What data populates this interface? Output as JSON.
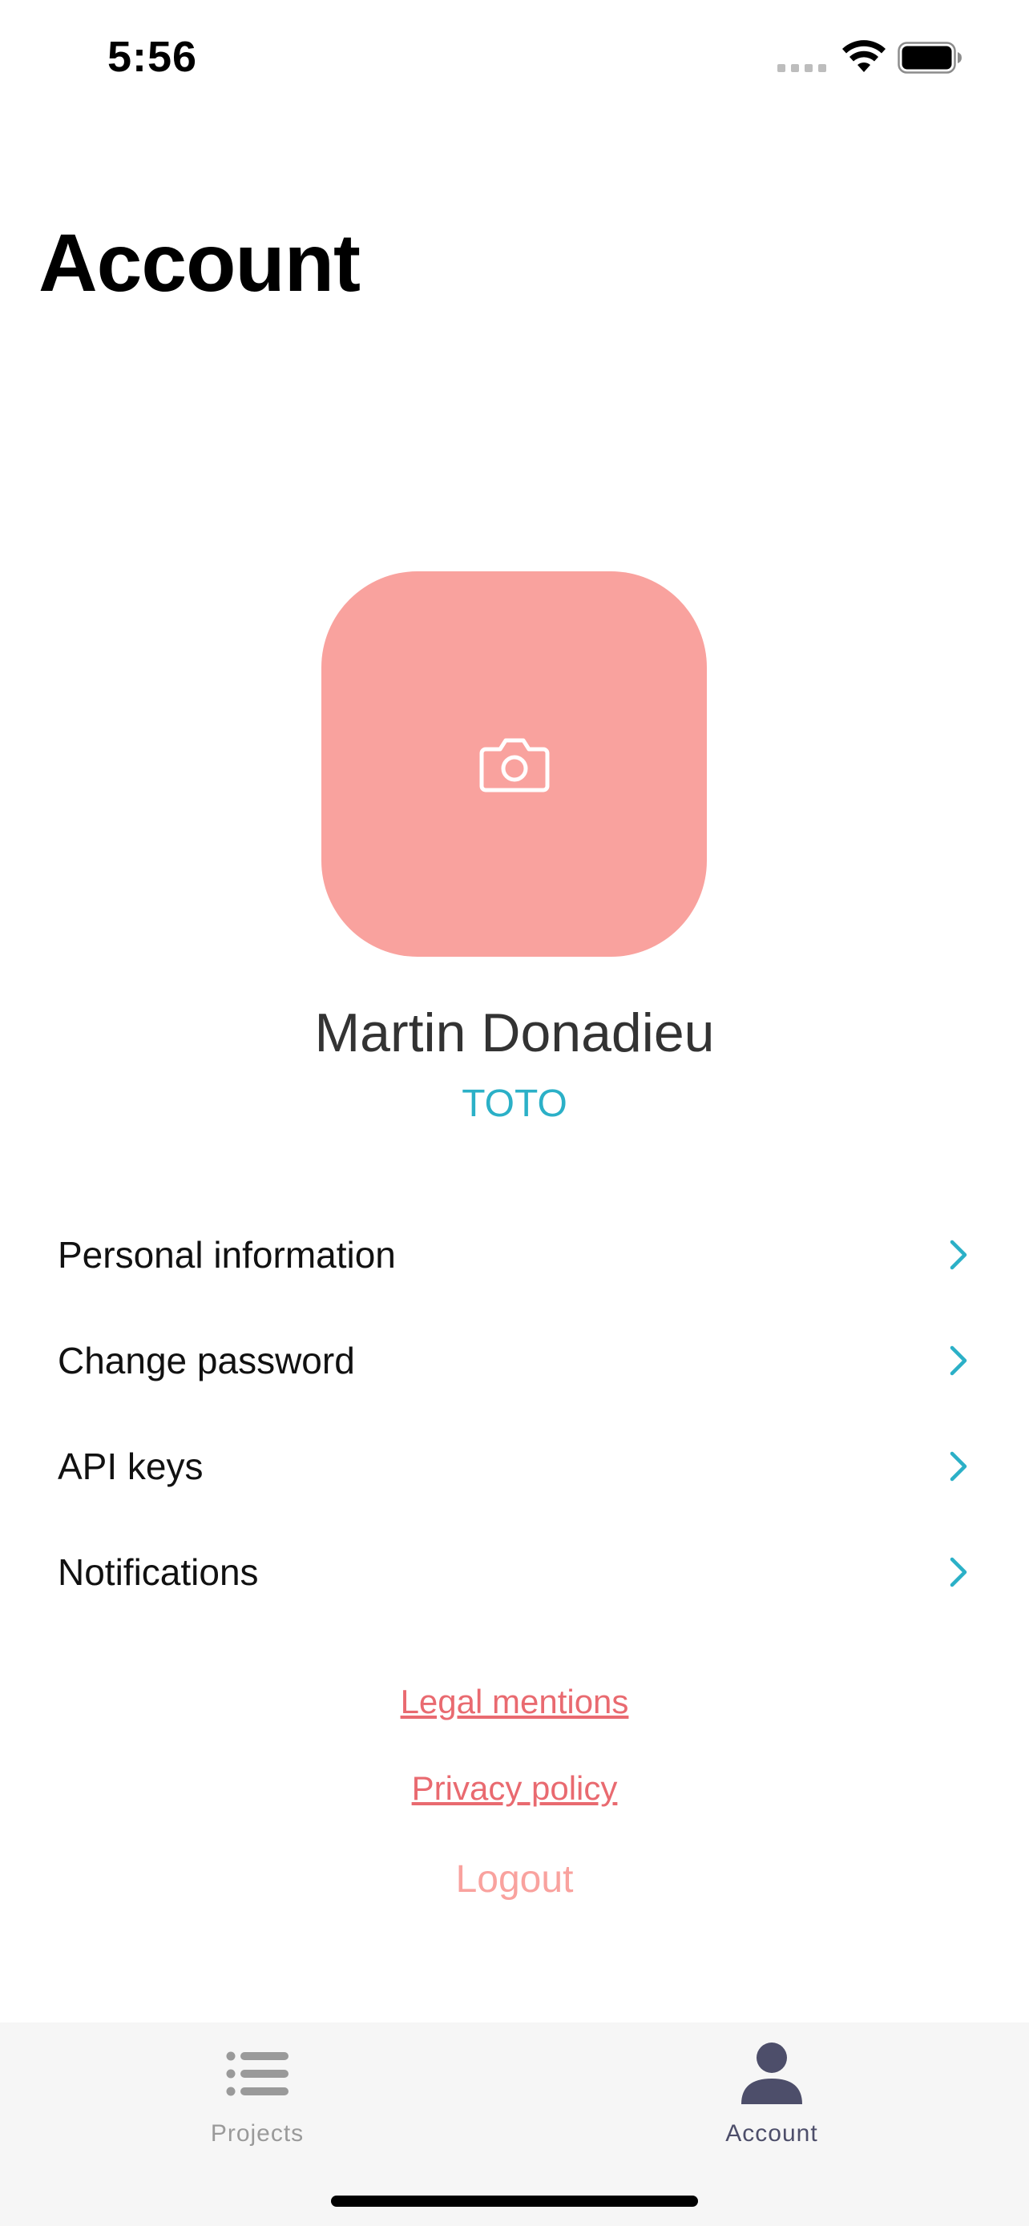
{
  "status_bar": {
    "time": "5:56"
  },
  "header": {
    "title": "Account"
  },
  "profile": {
    "name": "Martin Donadieu",
    "organization": "TOTO",
    "avatar_icon": "camera-icon",
    "avatar_color": "#f9a29e"
  },
  "menu": {
    "items": [
      {
        "label": "Personal information",
        "icon": "chevron-right-icon"
      },
      {
        "label": "Change password",
        "icon": "chevron-right-icon"
      },
      {
        "label": "API keys",
        "icon": "chevron-right-icon"
      },
      {
        "label": "Notifications",
        "icon": "chevron-right-icon"
      }
    ]
  },
  "links": {
    "legal": "Legal mentions",
    "privacy": "Privacy policy",
    "logout": "Logout"
  },
  "tabbar": {
    "tabs": [
      {
        "label": "Projects",
        "icon": "list-icon",
        "active": false
      },
      {
        "label": "Account",
        "icon": "person-icon",
        "active": true
      }
    ]
  },
  "colors": {
    "accent": "#2bb0c7",
    "link": "#e96a70",
    "logout": "#f9a29e",
    "tab_active": "#4d4e6a"
  }
}
